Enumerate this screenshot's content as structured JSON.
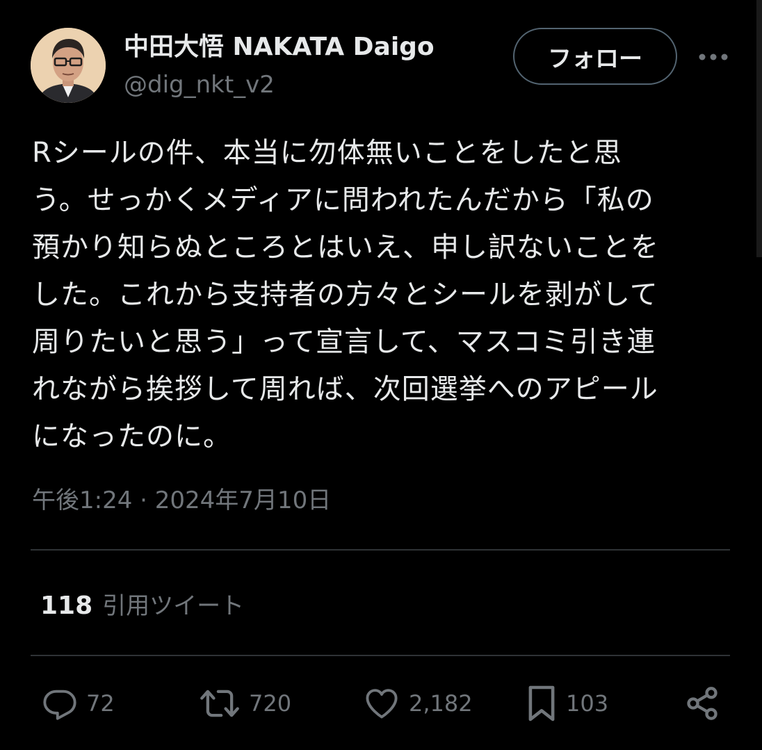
{
  "author": {
    "display_name": "中田大悟 NAKATA Daigo",
    "handle": "@dig_nkt_v2"
  },
  "header": {
    "follow_label": "フォロー",
    "more_icon": "more-icon"
  },
  "tweet": {
    "lines": [
      "Rシールの件、本当に勿体無いことをしたと思",
      "う。せっかくメディアに問われたんだから「私の",
      "預かり知らぬところとはいえ、申し訳ないことを",
      "した。これから支持者の方々とシールを剥がして",
      "周りたいと思う」って宣言して、マスコミ引き連",
      "れながら挨拶して周れば、次回選挙へのアピール",
      "になったのに。"
    ],
    "timestamp": "午後1:24 · 2024年7月10日"
  },
  "stats": {
    "quote_count": "118",
    "quote_label": "引用ツイート"
  },
  "actions": {
    "reply": {
      "icon": "reply-icon",
      "count": "72"
    },
    "retweet": {
      "icon": "retweet-icon",
      "count": "720"
    },
    "like": {
      "icon": "heart-icon",
      "count": "2,182"
    },
    "bookmark": {
      "icon": "bookmark-icon",
      "count": "103"
    },
    "share": {
      "icon": "share-icon"
    }
  },
  "colors": {
    "background": "#000000",
    "text_primary": "#e7e9ea",
    "text_secondary": "#71767b",
    "divider": "#2f3336",
    "follow_border": "#536471"
  }
}
